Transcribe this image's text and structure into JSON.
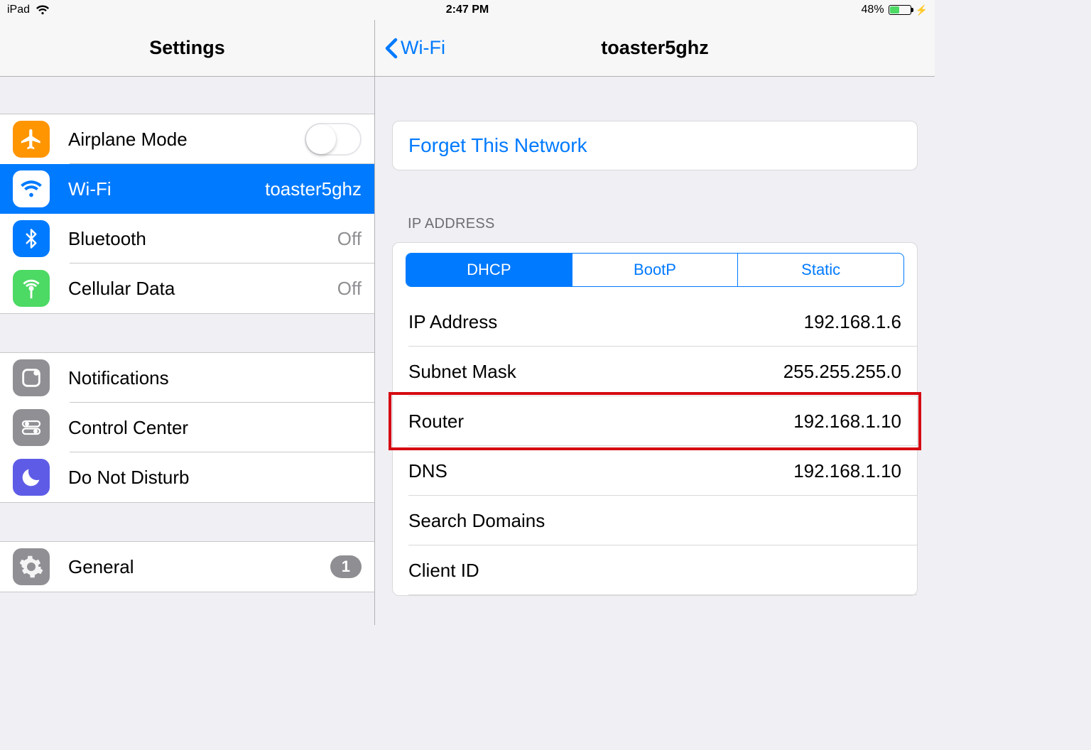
{
  "status_bar": {
    "device": "iPad",
    "time": "2:47 PM",
    "battery_pct": "48%",
    "battery_fill_pct": 48
  },
  "sidebar": {
    "title": "Settings",
    "groups": [
      {
        "rows": [
          {
            "icon": "airplane",
            "label": "Airplane Mode",
            "accessory": "toggle",
            "toggle_on": false
          },
          {
            "icon": "wifi",
            "label": "Wi-Fi",
            "detail": "toaster5ghz",
            "selected": true
          },
          {
            "icon": "bluetooth",
            "label": "Bluetooth",
            "detail": "Off"
          },
          {
            "icon": "cellular",
            "label": "Cellular Data",
            "detail": "Off"
          }
        ]
      },
      {
        "rows": [
          {
            "icon": "notifications",
            "label": "Notifications"
          },
          {
            "icon": "control",
            "label": "Control Center"
          },
          {
            "icon": "dnd",
            "label": "Do Not Disturb"
          }
        ]
      },
      {
        "rows": [
          {
            "icon": "general",
            "label": "General",
            "accessory": "badge",
            "badge": "1"
          }
        ]
      }
    ]
  },
  "detail": {
    "back_label": "Wi-Fi",
    "title": "toaster5ghz",
    "forget_label": "Forget This Network",
    "ip_section_header": "IP ADDRESS",
    "segments": [
      "DHCP",
      "BootP",
      "Static"
    ],
    "segment_active_index": 0,
    "ip_rows": [
      {
        "label": "IP Address",
        "value": "192.168.1.6"
      },
      {
        "label": "Subnet Mask",
        "value": "255.255.255.0"
      },
      {
        "label": "Router",
        "value": "192.168.1.10",
        "highlight": true
      },
      {
        "label": "DNS",
        "value": "192.168.1.10"
      },
      {
        "label": "Search Domains",
        "value": ""
      },
      {
        "label": "Client ID",
        "value": ""
      }
    ]
  },
  "colors": {
    "ios_blue": "#007aff",
    "ios_green": "#4cd964",
    "ios_orange": "#ff9500",
    "ios_gray": "#8e8e93",
    "highlight_red": "#d60b12"
  }
}
